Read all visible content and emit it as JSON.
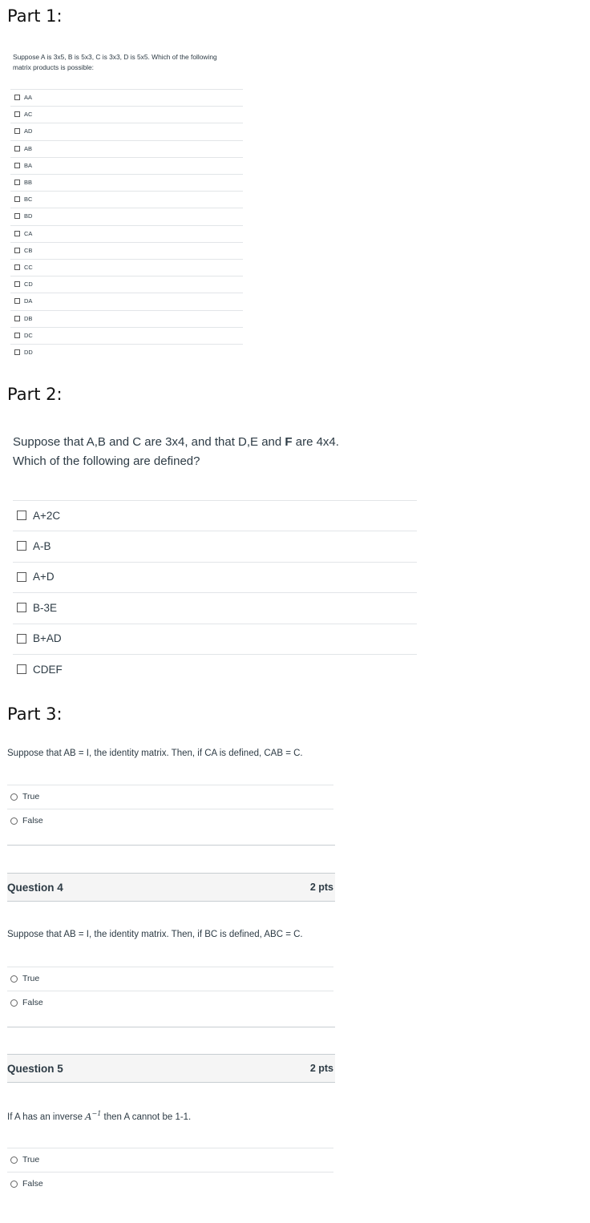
{
  "part1": {
    "title": "Part 1:",
    "question_line1": "Suppose A is 3x5, B is 5x3, C is 3x3, D is 5x5.   Which of the following",
    "question_line2": "matrix products is possible:",
    "options": [
      "AA",
      "AC",
      "AD",
      "AB",
      "BA",
      "BB",
      "BC",
      "BD",
      "CA",
      "CB",
      "CC",
      "CD",
      "DA",
      "DB",
      "DC",
      "DD"
    ]
  },
  "part2": {
    "title": "Part 2:",
    "question_line1_pre": "Suppose that A,B and C are 3x4, and that D,E and ",
    "question_line1_bold": "F",
    "question_line1_post": " are 4x4.",
    "question_line2": "Which of the following are defined?",
    "options": [
      "A+2C",
      "A-B",
      "A+D",
      "B-3E",
      "B+AD",
      "CDEF"
    ]
  },
  "part3": {
    "title": "Part 3:",
    "question": "Suppose that AB = I, the identity matrix.   Then, if CA is defined, CAB = C.",
    "options": [
      "True",
      "False"
    ]
  },
  "question4": {
    "title": "Question 4",
    "points": "2 pts",
    "question": "Suppose that AB = I, the identity matrix.   Then, if BC is defined, ABC = C.",
    "options": [
      "True",
      "False"
    ]
  },
  "question5": {
    "title": "Question 5",
    "points": "2 pts",
    "question_pre": "If A has an inverse ",
    "math_base": "A",
    "math_exp": "−1",
    "question_post": " then A cannot be 1-1.",
    "options": [
      "True",
      "False"
    ]
  },
  "icons": {
    "checkbox": "checkbox-icon",
    "radio": "radio-icon"
  }
}
